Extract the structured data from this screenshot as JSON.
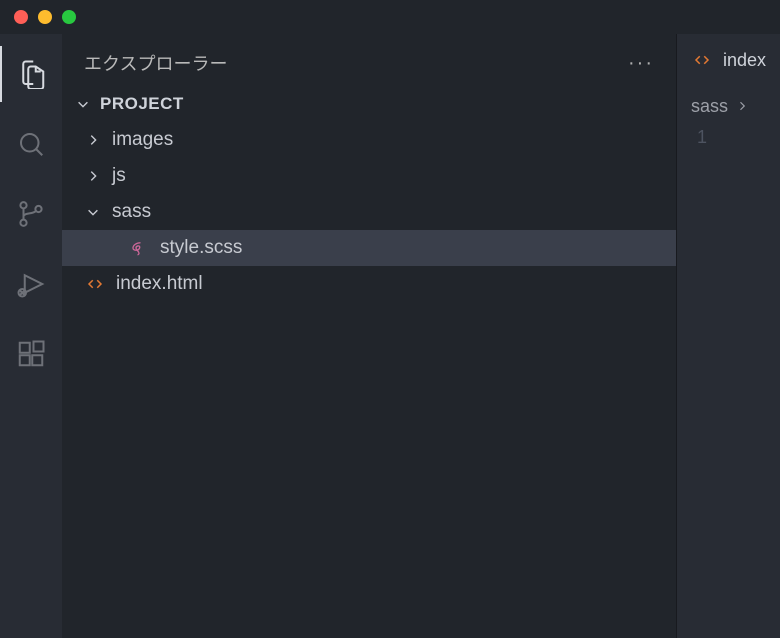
{
  "titlebar": {},
  "activitybar": {
    "items": [
      {
        "name": "explorer",
        "active": true
      },
      {
        "name": "search",
        "active": false
      },
      {
        "name": "source-control",
        "active": false
      },
      {
        "name": "run-debug",
        "active": false
      },
      {
        "name": "extensions",
        "active": false
      }
    ]
  },
  "sidebar": {
    "title": "エクスプローラー",
    "project_label": "PROJECT",
    "tree": [
      {
        "type": "folder",
        "label": "images",
        "expanded": false,
        "depth": 1
      },
      {
        "type": "folder",
        "label": "js",
        "expanded": false,
        "depth": 1
      },
      {
        "type": "folder",
        "label": "sass",
        "expanded": true,
        "depth": 1
      },
      {
        "type": "file",
        "label": "style.scss",
        "icon": "sass",
        "depth": 2,
        "selected": true
      },
      {
        "type": "file",
        "label": "index.html",
        "icon": "html",
        "depth": 1,
        "selected": false
      }
    ]
  },
  "editor": {
    "tab": {
      "icon": "html",
      "label": "index"
    },
    "breadcrumb": {
      "segment": "sass"
    },
    "gutter": {
      "line1": "1"
    }
  },
  "colors": {
    "sass_icon": "#cd6799",
    "html_icon": "#e37933"
  }
}
